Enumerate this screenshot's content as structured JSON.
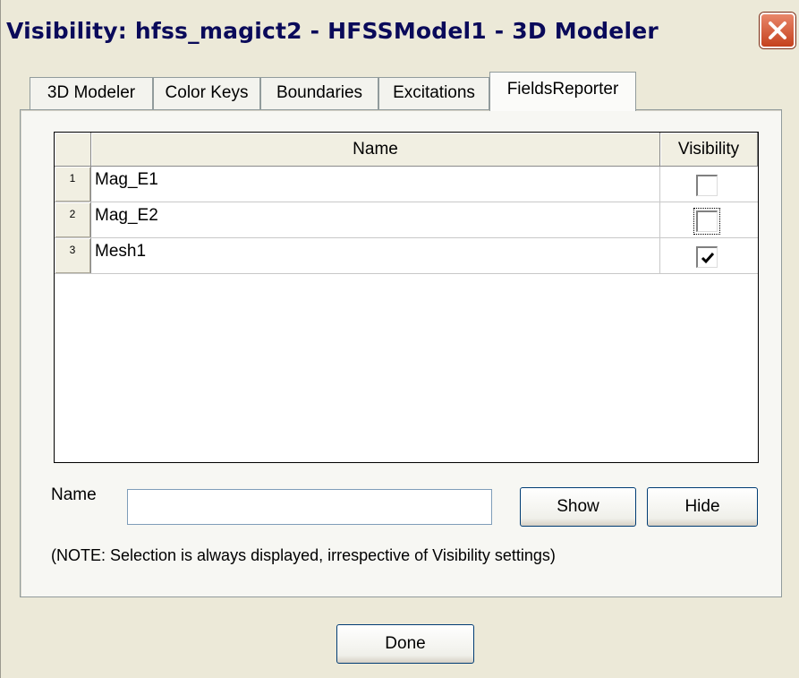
{
  "window": {
    "title": "Visibility: hfss_magict2 - HFSSModel1 - 3D Modeler",
    "close_icon": "close-x-icon",
    "close_color": "#c5411d"
  },
  "tabs": [
    {
      "label": "3D Modeler",
      "active": false
    },
    {
      "label": "Color Keys",
      "active": false
    },
    {
      "label": "Boundaries",
      "active": false
    },
    {
      "label": "Excitations",
      "active": false
    },
    {
      "label": "FieldsReporter",
      "active": true
    }
  ],
  "grid": {
    "columns": [
      "Name",
      "Visibility"
    ],
    "rows": [
      {
        "num": "1",
        "name": "Mag_E1",
        "visible": false
      },
      {
        "num": "2",
        "name": "Mag_E2",
        "visible": false,
        "focused": true
      },
      {
        "num": "3",
        "name": "Mesh1",
        "visible": true
      }
    ]
  },
  "filter": {
    "name_label": "Name",
    "name_value": "",
    "show_label": "Show",
    "hide_label": "Hide"
  },
  "note": "(NOTE: Selection is always displayed, irrespective of Visibility settings)",
  "footer": {
    "done_label": "Done"
  }
}
